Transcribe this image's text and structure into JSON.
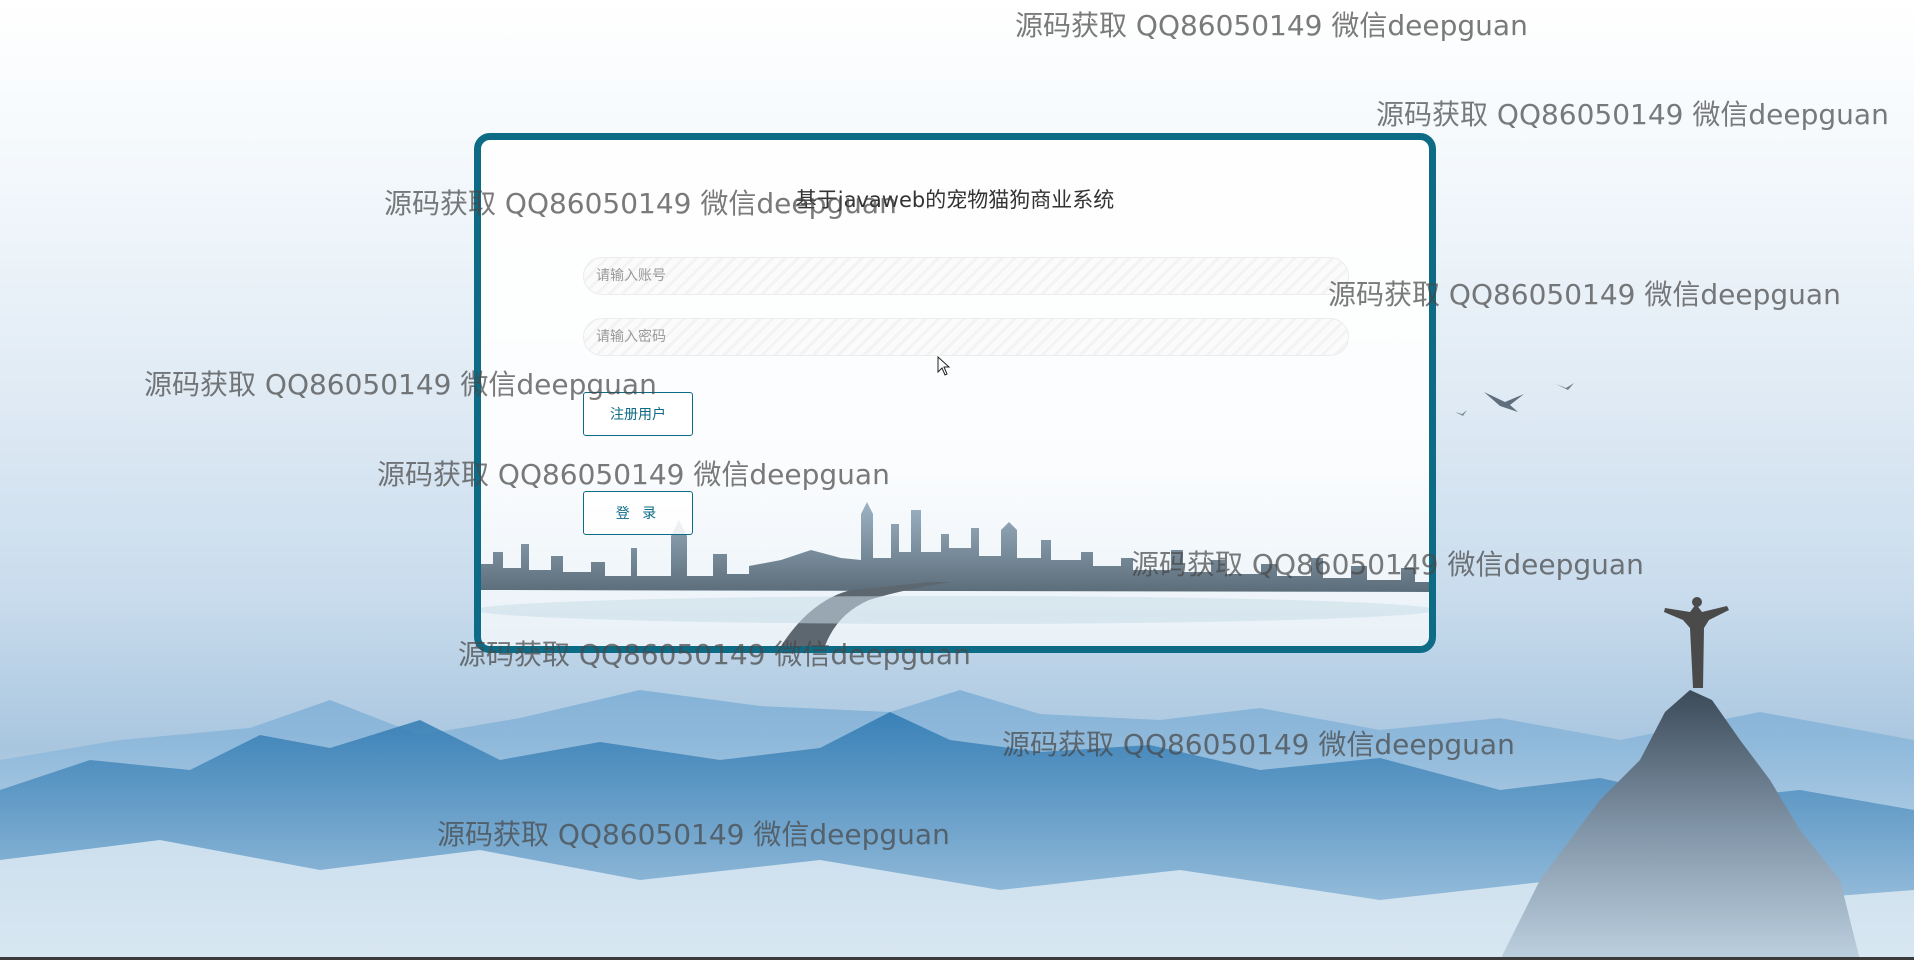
{
  "login": {
    "title": "基于javaweb的宠物猫狗商业系统",
    "account_placeholder": "请输入账号",
    "password_placeholder": "请输入密码",
    "register_label": "注册用户",
    "login_label": "登 录"
  },
  "watermark_text": "源码获取 QQ86050149 微信deepguan",
  "colors": {
    "accent": "#0e6b86",
    "watermark": "#555555",
    "sky_top": "#ffffff",
    "mountain": "#2f7fb8"
  }
}
